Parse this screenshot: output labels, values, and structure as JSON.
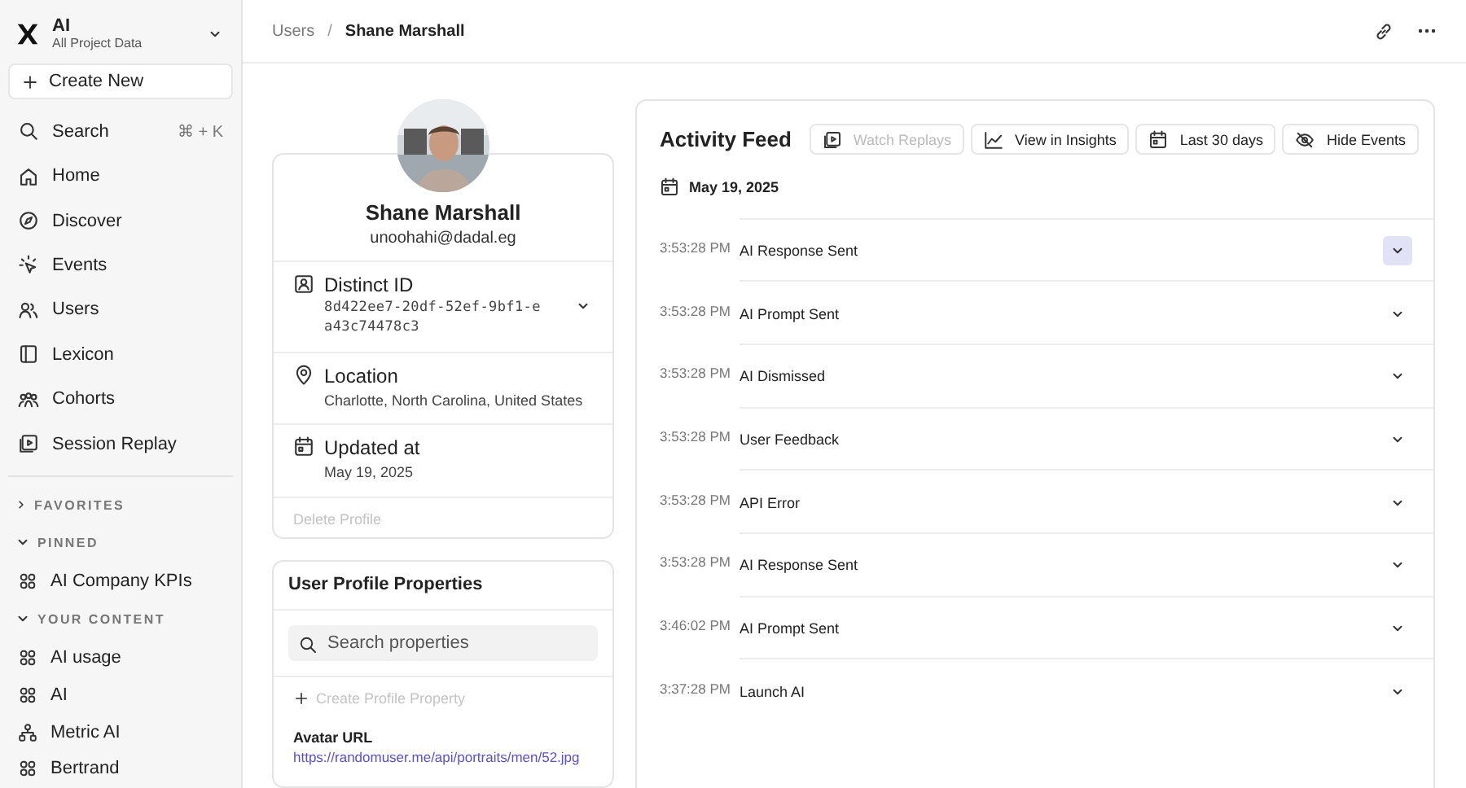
{
  "project": {
    "name": "AI",
    "subtitle": "All Project Data"
  },
  "create_button": "Create New",
  "search": {
    "label": "Search",
    "shortcut": "⌘ + K"
  },
  "nav": [
    {
      "label": "Home"
    },
    {
      "label": "Discover"
    },
    {
      "label": "Events"
    },
    {
      "label": "Users"
    },
    {
      "label": "Lexicon"
    },
    {
      "label": "Cohorts"
    },
    {
      "label": "Session Replay"
    }
  ],
  "sections": [
    {
      "title": "FAVORITES",
      "expanded": false
    },
    {
      "title": "PINNED",
      "expanded": true,
      "items": [
        {
          "label": "AI Company KPIs",
          "kind": "board"
        }
      ]
    },
    {
      "title": "YOUR CONTENT",
      "expanded": true,
      "items": [
        {
          "label": "AI usage",
          "kind": "board"
        },
        {
          "label": "AI",
          "kind": "board"
        },
        {
          "label": "Metric AI",
          "kind": "metric"
        },
        {
          "label": "Bertrand",
          "kind": "board"
        }
      ]
    }
  ],
  "breadcrumb": [
    "Users",
    "Shane Marshall"
  ],
  "breadcrumb_separator": "/",
  "profile": {
    "name": "Shane Marshall",
    "email": "unoohahi@dadal.eg",
    "fields": [
      {
        "label": "Distinct ID",
        "value": "8d422ee7-20df-52ef-9bf1-ea43c74478c3",
        "kind": "id"
      },
      {
        "label": "Location",
        "value": "Charlotte, North Carolina, United States",
        "kind": "location"
      },
      {
        "label": "Updated at",
        "value": "May 19, 2025",
        "kind": "date"
      }
    ],
    "delete": {
      "label": "Delete Profile",
      "disabled": true
    }
  },
  "properties": {
    "title": "User Profile Properties",
    "search_placeholder": "Search properties",
    "create": {
      "label": "Create Profile Property",
      "disabled": true
    },
    "items": [
      {
        "name": "Avatar URL",
        "value": "https://randomuser.me/api/portraits/men/52.jpg"
      }
    ]
  },
  "activity": {
    "title": "Activity Feed",
    "buttons": [
      {
        "label": "Watch Replays",
        "kind": "replay",
        "disabled": true
      },
      {
        "label": "View in Insights",
        "kind": "chart",
        "disabled": false
      },
      {
        "label": "Last 30 days",
        "kind": "calendar",
        "disabled": false
      },
      {
        "label": "Hide Events",
        "kind": "hide",
        "disabled": false
      }
    ],
    "date": "May 19, 2025",
    "events": [
      {
        "time": "3:53:28 PM",
        "name": "AI Response Sent",
        "highlighted": true
      },
      {
        "time": "3:53:28 PM",
        "name": "AI Prompt Sent",
        "highlighted": false
      },
      {
        "time": "3:53:28 PM",
        "name": "AI Dismissed",
        "highlighted": false
      },
      {
        "time": "3:53:28 PM",
        "name": "User Feedback",
        "highlighted": false
      },
      {
        "time": "3:53:28 PM",
        "name": "API Error",
        "highlighted": false
      },
      {
        "time": "3:53:28 PM",
        "name": "AI Response Sent",
        "highlighted": false
      },
      {
        "time": "3:46:02 PM",
        "name": "AI Prompt Sent",
        "highlighted": false
      },
      {
        "time": "3:37:28 PM",
        "name": "Launch AI",
        "highlighted": false
      }
    ]
  }
}
